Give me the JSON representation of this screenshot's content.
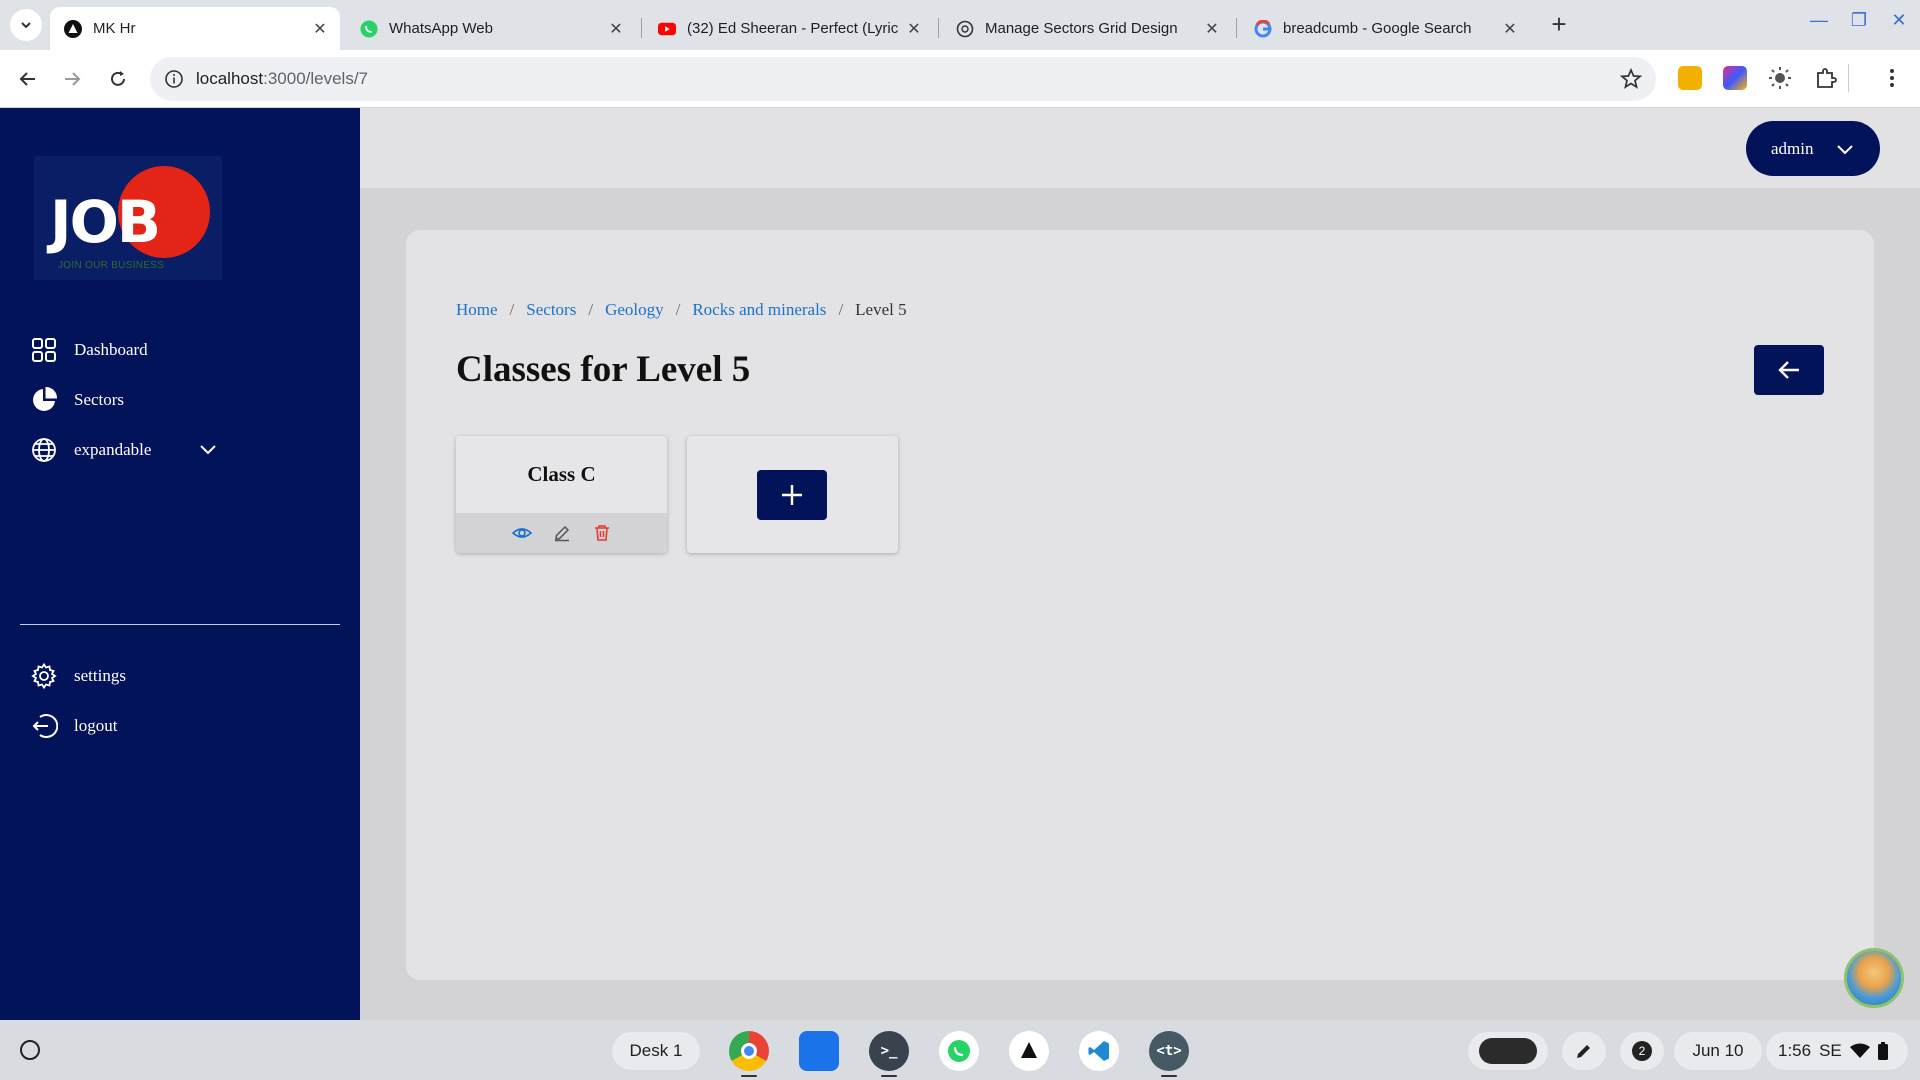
{
  "browser": {
    "tabs": [
      {
        "title": "MK Hr",
        "favicon": "triangle-logo-icon",
        "active": true
      },
      {
        "title": "WhatsApp Web",
        "favicon": "whatsapp-icon",
        "active": false
      },
      {
        "title": "(32) Ed Sheeran - Perfect (Lyric",
        "favicon": "youtube-icon",
        "active": false
      },
      {
        "title": "Manage Sectors Grid Design",
        "favicon": "chatgpt-icon",
        "active": false
      },
      {
        "title": "breadcumb - Google Search",
        "favicon": "google-icon",
        "active": false
      }
    ],
    "url_host": "localhost",
    "url_path": ":3000/levels/7"
  },
  "sidebar": {
    "logo": {
      "word": "JOB",
      "tagline": "JOIN OUR BUSINESS"
    },
    "items": [
      {
        "label": "Dashboard",
        "icon": "grid-icon"
      },
      {
        "label": "Sectors",
        "icon": "pie-chart-icon"
      },
      {
        "label": "expandable",
        "icon": "globe-icon"
      }
    ],
    "bottom_items": [
      {
        "label": "settings",
        "icon": "gear-icon"
      },
      {
        "label": "logout",
        "icon": "logout-icon"
      }
    ]
  },
  "header": {
    "user_label": "admin"
  },
  "breadcrumb": {
    "items": [
      "Home",
      "Sectors",
      "Geology",
      "Rocks and minerals"
    ],
    "separator": "/",
    "current": "Level 5"
  },
  "page": {
    "title": "Classes for Level 5"
  },
  "classes": [
    {
      "name": "Class C",
      "actions": [
        "view",
        "edit",
        "delete"
      ]
    }
  ],
  "shelf": {
    "desk_label": "Desk 1",
    "notification_count": "2",
    "date": "Jun 10",
    "time": "1:56",
    "locale": "SE"
  },
  "colors": {
    "primary": "#03135a",
    "link": "#1a73c8",
    "danger": "#e53935",
    "logo_red": "#e32417"
  }
}
